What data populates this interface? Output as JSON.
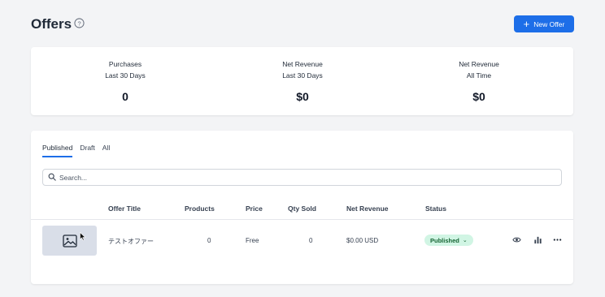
{
  "header": {
    "title": "Offers",
    "new_offer_label": "New Offer"
  },
  "stats": [
    {
      "label_line1": "Purchases",
      "label_line2": "Last 30 Days",
      "value": "0"
    },
    {
      "label_line1": "Net Revenue",
      "label_line2": "Last 30 Days",
      "value": "$0"
    },
    {
      "label_line1": "Net Revenue",
      "label_line2": "All Time",
      "value": "$0"
    }
  ],
  "tabs": [
    {
      "label": "Published",
      "active": true
    },
    {
      "label": "Draft",
      "active": false
    },
    {
      "label": "All",
      "active": false
    }
  ],
  "search": {
    "placeholder": "Search..."
  },
  "table": {
    "columns": [
      "Offer Title",
      "Products",
      "Price",
      "Qty Sold",
      "Net Revenue",
      "Status"
    ],
    "rows": [
      {
        "title": "テストオファー",
        "products": "0",
        "price": "Free",
        "qty_sold": "0",
        "net_revenue": "$0.00 USD",
        "status": "Published"
      }
    ]
  },
  "colors": {
    "accent": "#1d6ee8",
    "status_published_bg": "#d1f5e4",
    "status_published_text": "#166534"
  },
  "icons": [
    "help-circle-icon",
    "plus-icon",
    "search-icon",
    "image-placeholder-icon",
    "eye-icon",
    "bar-chart-icon",
    "more-horizontal-icon",
    "chevron-down-icon"
  ]
}
